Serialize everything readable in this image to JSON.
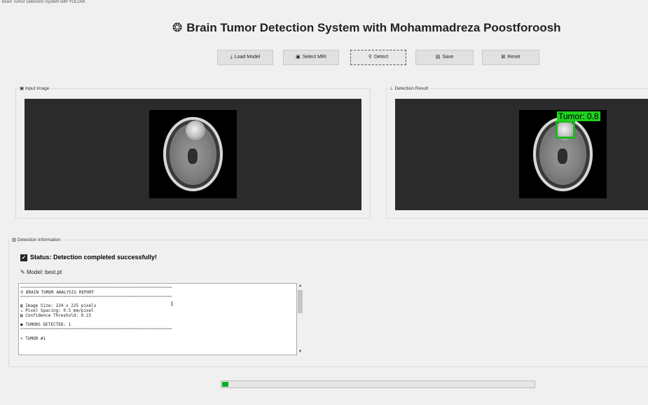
{
  "window": {
    "title": "Brain Tumor Detection System with YOLOv8"
  },
  "header": {
    "title": "Brain Tumor Detection System with Mohammadreza Poostforoosh",
    "icon": "brain-icon"
  },
  "toolbar": {
    "buttons": [
      {
        "label": "Load Model",
        "icon": "download-icon"
      },
      {
        "label": "Select MRI",
        "icon": "image-icon"
      },
      {
        "label": "Detect",
        "icon": "search-icon"
      },
      {
        "label": "Save",
        "icon": "save-icon"
      },
      {
        "label": "Reset",
        "icon": "reset-icon"
      }
    ]
  },
  "panels": {
    "input": {
      "label": "Input Image",
      "icon": "image-icon"
    },
    "result": {
      "label": "Detection Result",
      "icon": "target-icon"
    },
    "info": {
      "label": "Detection Information",
      "icon": "chart-icon"
    }
  },
  "detection": {
    "box_label": "Tumor: 0.8",
    "box_color": "#1db71d"
  },
  "info": {
    "status": "Status: Detection completed successfully!",
    "model": "Model: best.pt",
    "report_lines": [
      "============================================================",
      "BRAIN TUMOR ANALYSIS REPORT",
      "============================================================",
      "",
      "Image Size: 224 x 225 pixels",
      "Pixel Spacing: 0.5 mm/pixel",
      "Confidence Threshold: 0.15",
      "",
      "TUMORS DETECTED: 1",
      "============================================================",
      "",
      "TUMOR #1"
    ]
  },
  "progress": {
    "value": 0.02,
    "color": "#06b025"
  }
}
